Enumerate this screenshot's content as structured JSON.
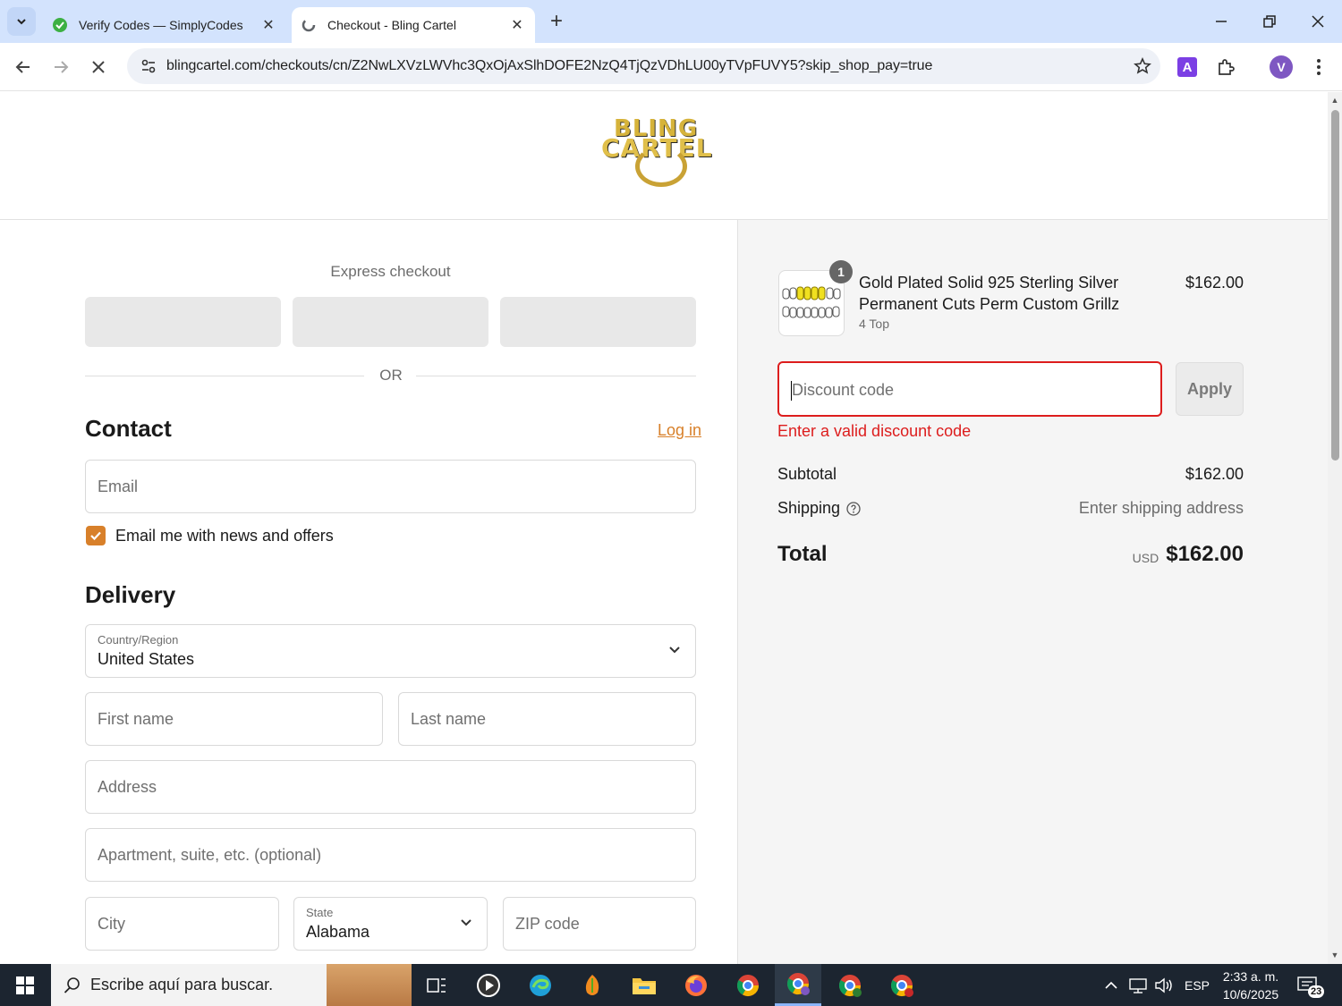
{
  "browser": {
    "tabs": [
      {
        "title": "Verify Codes — SimplyCodes",
        "active": false
      },
      {
        "title": "Checkout - Bling Cartel",
        "active": true
      }
    ],
    "url": "blingcartel.com/checkouts/cn/Z2NwLXVzLWVhc3QxOjAxSlhDOFE2NzQ4TjQzVDhLU00yTVpFUVY5?skip_shop_pay=true",
    "profile_initial": "V",
    "extension_letter": "A"
  },
  "header": {
    "logo_line1": "BLING",
    "logo_line2": "CARTEL"
  },
  "express": {
    "label": "Express checkout",
    "or_text": "OR"
  },
  "contact": {
    "title": "Contact",
    "login_label": "Log in",
    "email_placeholder": "Email",
    "news_label": "Email me with news and offers",
    "news_checked": true
  },
  "delivery": {
    "title": "Delivery",
    "country_label": "Country/Region",
    "country_value": "United States",
    "first_name_placeholder": "First name",
    "last_name_placeholder": "Last name",
    "address_placeholder": "Address",
    "apartment_placeholder": "Apartment, suite, etc. (optional)",
    "city_placeholder": "City",
    "state_label": "State",
    "state_value": "Alabama",
    "zip_placeholder": "ZIP code"
  },
  "summary": {
    "product": {
      "quantity": "1",
      "title": "Gold Plated Solid 925 Sterling Silver Permanent Cuts Perm Custom Grillz",
      "variant": "4 Top",
      "price": "$162.00"
    },
    "discount_placeholder": "Discount code",
    "apply_label": "Apply",
    "discount_error": "Enter a valid discount code",
    "subtotal_label": "Subtotal",
    "subtotal_value": "$162.00",
    "shipping_label": "Shipping",
    "shipping_value": "Enter shipping address",
    "total_label": "Total",
    "total_currency": "USD",
    "total_value": "$162.00"
  },
  "taskbar": {
    "search_placeholder": "Escribe aquí para buscar.",
    "language": "ESP",
    "time": "2:33 a. m.",
    "date": "10/6/2025",
    "notifications": "23"
  },
  "colors": {
    "accent": "#d8802a",
    "error": "#dd1d1d",
    "tabbar": "#d3e3fd",
    "taskbar": "#1c2530"
  }
}
